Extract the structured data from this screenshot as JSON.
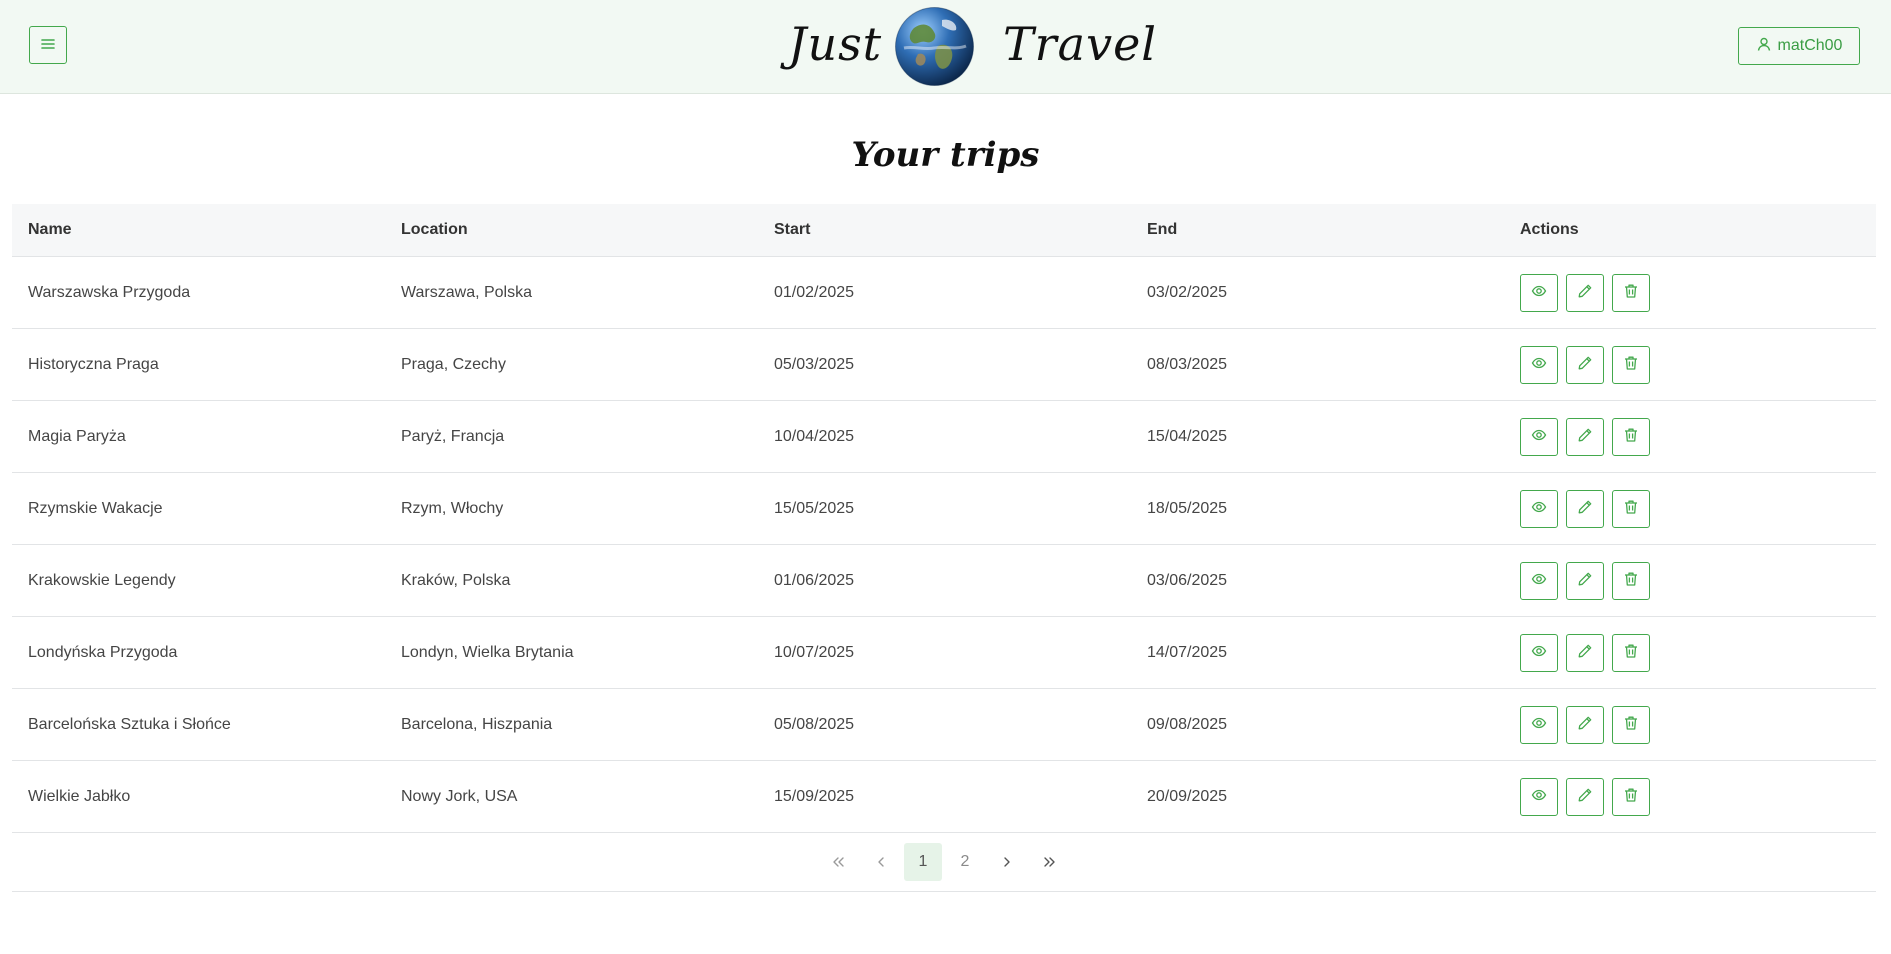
{
  "header": {
    "brand_left": "Just",
    "brand_right": "Travel",
    "user_label": "matCh00"
  },
  "page": {
    "title": "Your trips"
  },
  "table": {
    "columns": [
      "Name",
      "Location",
      "Start",
      "End",
      "Actions"
    ],
    "rows": [
      {
        "name": "Warszawska Przygoda",
        "location": "Warszawa, Polska",
        "start": "01/02/2025",
        "end": "03/02/2025"
      },
      {
        "name": "Historyczna Praga",
        "location": "Praga, Czechy",
        "start": "05/03/2025",
        "end": "08/03/2025"
      },
      {
        "name": "Magia Paryża",
        "location": "Paryż, Francja",
        "start": "10/04/2025",
        "end": "15/04/2025"
      },
      {
        "name": "Rzymskie Wakacje",
        "location": "Rzym, Włochy",
        "start": "15/05/2025",
        "end": "18/05/2025"
      },
      {
        "name": "Krakowskie Legendy",
        "location": "Kraków, Polska",
        "start": "01/06/2025",
        "end": "03/06/2025"
      },
      {
        "name": "Londyńska Przygoda",
        "location": "Londyn, Wielka Brytania",
        "start": "10/07/2025",
        "end": "14/07/2025"
      },
      {
        "name": "Barcelońska Sztuka i Słońce",
        "location": "Barcelona, Hiszpania",
        "start": "05/08/2025",
        "end": "09/08/2025"
      },
      {
        "name": "Wielkie Jabłko",
        "location": "Nowy Jork, USA",
        "start": "15/09/2025",
        "end": "20/09/2025"
      }
    ],
    "row_actions": [
      "eye-icon",
      "pencil-icon",
      "trash-icon"
    ]
  },
  "pagination": {
    "pages": [
      "1",
      "2"
    ],
    "current": "1"
  },
  "colors": {
    "accent": "#43a84c",
    "header_bg": "#f2f9f3",
    "active_page_bg": "#e6f3e8"
  }
}
